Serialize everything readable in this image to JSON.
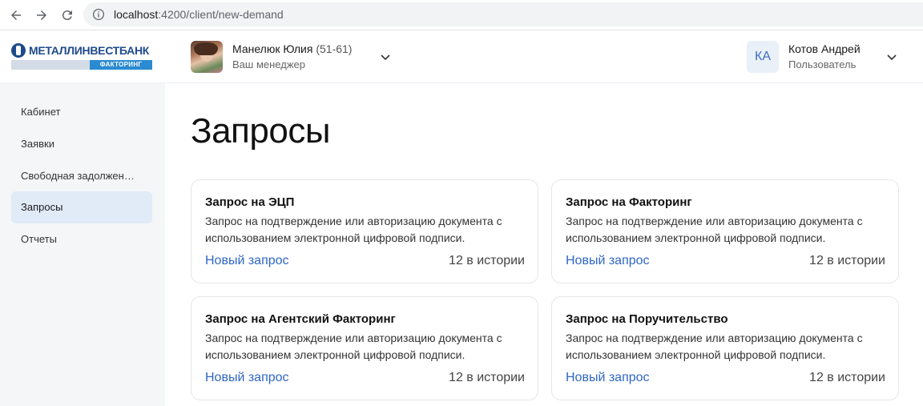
{
  "browser": {
    "url_host": "localhost",
    "url_rest": ":4200/client/new-demand"
  },
  "logo": {
    "name": "МЕТАЛЛИНВЕСТБАНК",
    "tag": "ФАКТОРИНГ"
  },
  "manager": {
    "name": "Манелюк Юлия",
    "code": "(51-61)",
    "role": "Ваш менеджер"
  },
  "user": {
    "initials": "КА",
    "name": "Котов Андрей",
    "role": "Пользователь"
  },
  "sidebar": {
    "items": [
      {
        "label": "Кабинет",
        "active": false
      },
      {
        "label": "Заявки",
        "active": false
      },
      {
        "label": "Свободная задолжен…",
        "active": false
      },
      {
        "label": "Запросы",
        "active": true
      },
      {
        "label": "Отчеты",
        "active": false
      }
    ]
  },
  "main": {
    "title": "Запросы",
    "cards": [
      {
        "title": "Запрос на ЭЦП",
        "description": "Запрос на подтверждение или авторизацию документа с использованием электронной цифровой подписи.",
        "link": "Новый запрос",
        "count": "12 в истории"
      },
      {
        "title": "Запрос на Факторинг",
        "description": "Запрос на подтверждение или авторизацию документа с использованием электронной цифровой подписи.",
        "link": "Новый запрос",
        "count": "12 в истории"
      },
      {
        "title": "Запрос на Агентский Факторинг",
        "description": "Запрос на подтверждение или авторизацию документа с использованием электронной цифровой подписи.",
        "link": "Новый запрос",
        "count": "12 в истории"
      },
      {
        "title": "Запрос на Поручительство",
        "description": "Запрос на подтверждение или авторизацию документа с использованием электронной цифровой подписи.",
        "link": "Новый запрос",
        "count": "12 в истории"
      }
    ]
  },
  "colors": {
    "accent": "#2f66c4",
    "sidebar_bg": "#f5f6f8",
    "sidebar_active": "#e1eaf7"
  },
  "icons": {
    "back": "arrow-left-icon",
    "forward": "arrow-right-icon",
    "reload": "reload-icon",
    "info": "info-icon",
    "chevron": "chevron-down-icon"
  }
}
